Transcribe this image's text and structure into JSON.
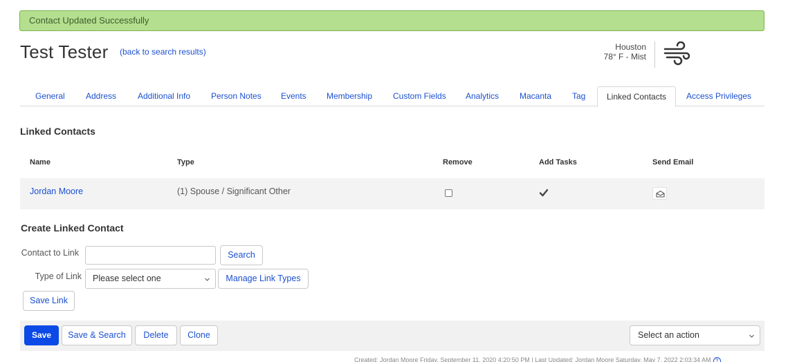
{
  "banner": {
    "message": "Contact Updated Successfully"
  },
  "header": {
    "title": "Test Tester",
    "back_link": "(back to search results)"
  },
  "weather": {
    "city": "Houston",
    "condition": "78° F - Mist",
    "icon": "wind-icon"
  },
  "tabs": [
    {
      "label": "General"
    },
    {
      "label": "Address"
    },
    {
      "label": "Additional Info"
    },
    {
      "label": "Person Notes"
    },
    {
      "label": "Events"
    },
    {
      "label": "Membership"
    },
    {
      "label": "Custom Fields"
    },
    {
      "label": "Analytics"
    },
    {
      "label": "Macanta"
    },
    {
      "label": "Tag"
    },
    {
      "label": "Linked Contacts",
      "active": true
    },
    {
      "label": "Access Privileges"
    }
  ],
  "linked": {
    "title": "Linked Contacts",
    "columns": {
      "name": "Name",
      "type": "Type",
      "remove": "Remove",
      "add_tasks": "Add Tasks",
      "send_email": "Send Email"
    },
    "rows": [
      {
        "name": "Jordan Moore",
        "type": "(1) Spouse / Significant Other",
        "remove": false,
        "add_tasks": true
      }
    ]
  },
  "create": {
    "title": "Create Linked Contact",
    "contact_label": "Contact to Link",
    "contact_value": "",
    "search_button": "Search",
    "type_label": "Type of Link",
    "type_select": "Please select one",
    "manage_button": "Manage Link Types",
    "save_link_button": "Save Link"
  },
  "footer": {
    "save": "Save",
    "save_search": "Save & Search",
    "delete": "Delete",
    "clone": "Clone",
    "action_select": "Select an action",
    "meta": "Created:  Jordan Moore Friday, September 11, 2020 4:20:50 PM  |  Last Updated:  Jordan Moore Saturday, May 7, 2022 2:03:34 AM"
  },
  "colors": {
    "link": "#1b4fd1",
    "primary": "#0b4ae6",
    "success_bg": "#b3df8f"
  }
}
